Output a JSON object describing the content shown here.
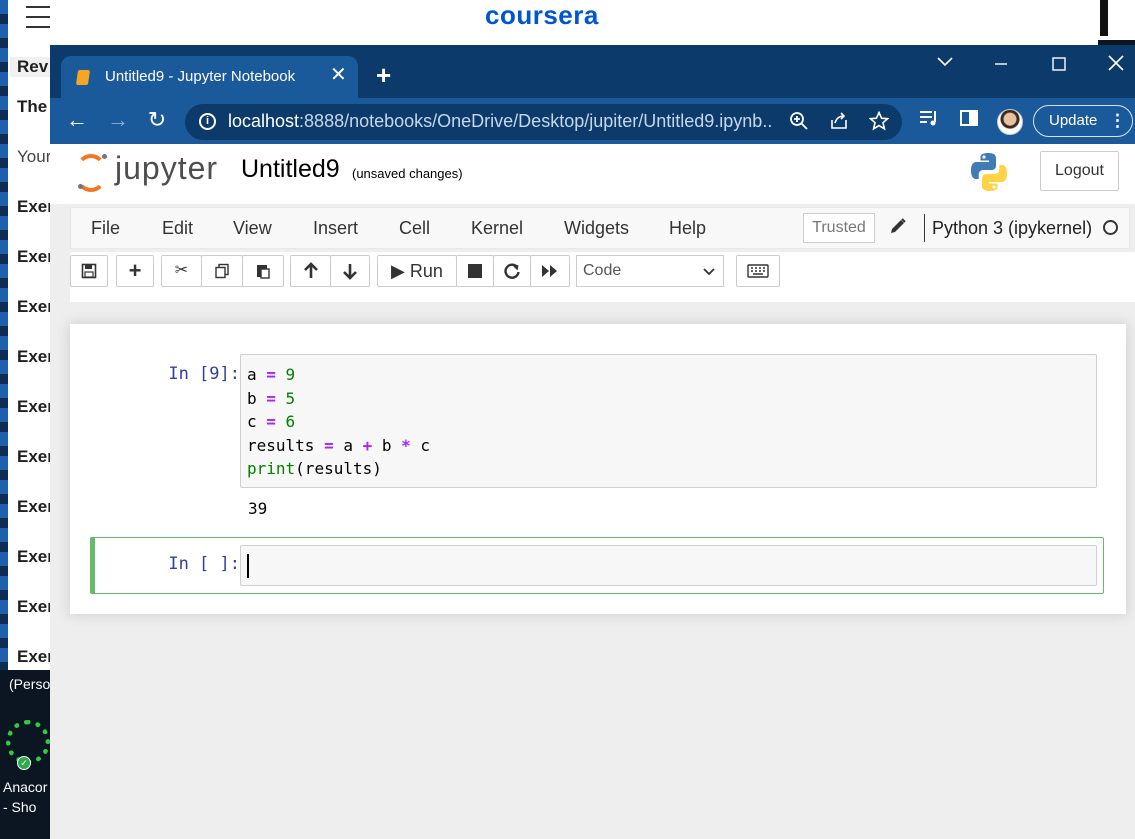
{
  "coursera": {
    "logo": "coursera",
    "side_lines": [
      "Rev",
      "The",
      "Your",
      "Exer",
      "Exer",
      "Exer",
      "Exer",
      "Exer",
      "Exer",
      "Exer",
      "Exer",
      "Exer",
      "Exer"
    ],
    "persona": "(Perso"
  },
  "desktop": {
    "icon_label_1": "Anacor",
    "icon_label_2": "- Sho"
  },
  "browser": {
    "tab_title": "Untitled9 - Jupyter Notebook",
    "tab_close": "✕",
    "new_tab": "+",
    "url_host": "localhost",
    "url_rest": ":8888/notebooks/OneDrive/Desktop/jupiter/Untitled9.ipynb...",
    "update_label": "Update"
  },
  "jupyter": {
    "logo_text": "jupyter",
    "notebook_title": "Untitled9",
    "save_status": "(unsaved changes)",
    "logout_label": "Logout",
    "menu": [
      "File",
      "Edit",
      "View",
      "Insert",
      "Cell",
      "Kernel",
      "Widgets",
      "Help"
    ],
    "trusted_label": "Trusted",
    "kernel_name": "Python 3 (ipykernel)",
    "run_label": "Run",
    "cell_type": "Code"
  },
  "cells": [
    {
      "prompt": "In [9]:",
      "code": [
        "a = 9",
        "b = 5",
        "c = 6",
        "results = a + b * c",
        "print(results)"
      ],
      "output": "39"
    },
    {
      "prompt": "In [ ]:",
      "code": [],
      "output": ""
    }
  ]
}
